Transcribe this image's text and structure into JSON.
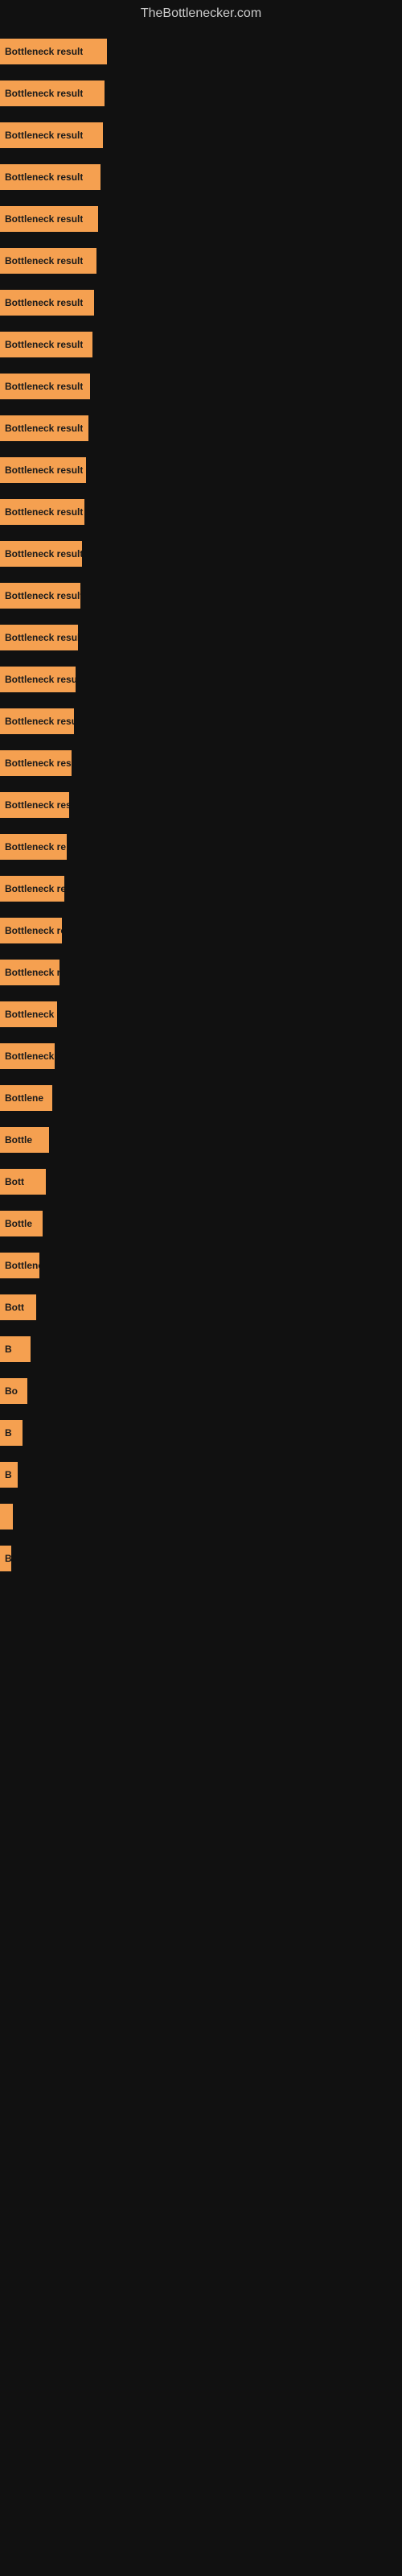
{
  "site": {
    "title": "TheBottlenecker.com"
  },
  "bars": [
    {
      "label": "Bottleneck result",
      "width": 133
    },
    {
      "label": "Bottleneck result",
      "width": 130
    },
    {
      "label": "Bottleneck result",
      "width": 128
    },
    {
      "label": "Bottleneck result",
      "width": 125
    },
    {
      "label": "Bottleneck result",
      "width": 122
    },
    {
      "label": "Bottleneck result",
      "width": 120
    },
    {
      "label": "Bottleneck result",
      "width": 117
    },
    {
      "label": "Bottleneck result",
      "width": 115
    },
    {
      "label": "Bottleneck result",
      "width": 112
    },
    {
      "label": "Bottleneck result",
      "width": 110
    },
    {
      "label": "Bottleneck result",
      "width": 107
    },
    {
      "label": "Bottleneck result",
      "width": 105
    },
    {
      "label": "Bottleneck result",
      "width": 102
    },
    {
      "label": "Bottleneck result",
      "width": 100
    },
    {
      "label": "Bottleneck result",
      "width": 97
    },
    {
      "label": "Bottleneck result",
      "width": 94
    },
    {
      "label": "Bottleneck result",
      "width": 92
    },
    {
      "label": "Bottleneck result",
      "width": 89
    },
    {
      "label": "Bottleneck resu",
      "width": 86
    },
    {
      "label": "Bottleneck re",
      "width": 83
    },
    {
      "label": "Bottleneck resu",
      "width": 80
    },
    {
      "label": "Bottleneck res",
      "width": 77
    },
    {
      "label": "Bottleneck result",
      "width": 74
    },
    {
      "label": "Bottleneck r",
      "width": 71
    },
    {
      "label": "Bottleneck resu",
      "width": 68
    },
    {
      "label": "Bottlene",
      "width": 65
    },
    {
      "label": "Bottle",
      "width": 61
    },
    {
      "label": "Bott",
      "width": 57
    },
    {
      "label": "Bottle",
      "width": 53
    },
    {
      "label": "Bottlenec",
      "width": 49
    },
    {
      "label": "Bott",
      "width": 45
    },
    {
      "label": "B",
      "width": 38
    },
    {
      "label": "Bo",
      "width": 34
    },
    {
      "label": "B",
      "width": 28
    },
    {
      "label": "B",
      "width": 22
    },
    {
      "label": "",
      "width": 16
    },
    {
      "label": "Bo",
      "width": 14
    }
  ]
}
